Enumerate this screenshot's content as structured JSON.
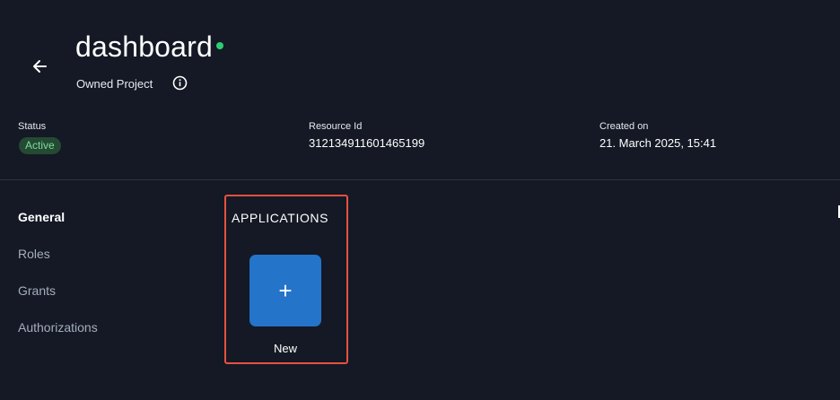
{
  "header": {
    "title": "dashboard",
    "subtitle": "Owned Project",
    "status_dot_color": "#2ecc71"
  },
  "meta": {
    "status_label": "Status",
    "status_value": "Active",
    "resource_label": "Resource Id",
    "resource_value": "312134911601465199",
    "created_label": "Created on",
    "created_value": "21. March 2025, 15:41"
  },
  "nav": {
    "items": [
      "General",
      "Roles",
      "Grants",
      "Authorizations"
    ],
    "active": "General"
  },
  "applications": {
    "section_title": "APPLICATIONS",
    "new_label": "New",
    "new_icon": "+"
  },
  "colors": {
    "background": "#141925",
    "accent": "#2474c9",
    "highlight": "#e8513f",
    "badge_bg": "#244a33",
    "badge_text": "#7fdc9c"
  }
}
